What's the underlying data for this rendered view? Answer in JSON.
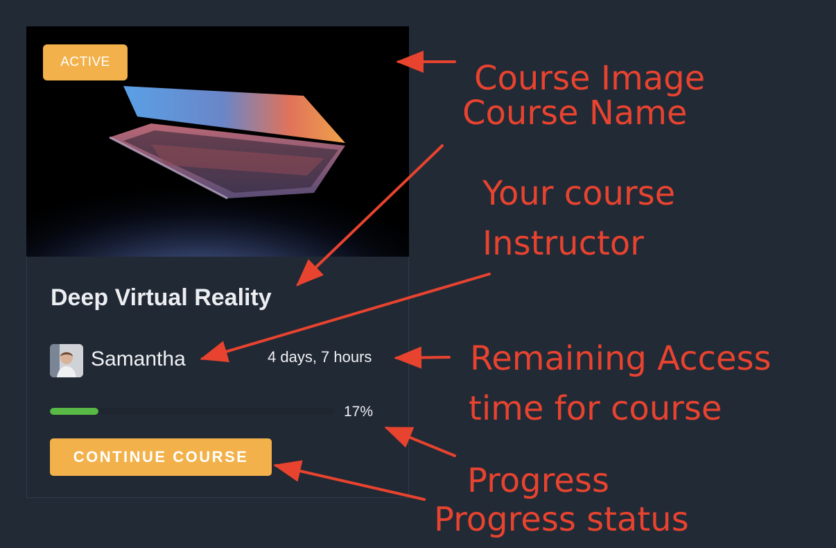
{
  "course_card": {
    "badge": "ACTIVE",
    "course_name": "Deep Virtual Reality",
    "instructor_name": "Samantha",
    "remaining_access": "4 days, 7 hours",
    "progress_fraction": 0.17,
    "progress_label": "17%",
    "cta_label": "CONTINUE COURSE"
  },
  "annotations": {
    "course_image": "Course Image",
    "course_name": "Course Name",
    "instructor_line1": "Your course",
    "instructor_line2": "Instructor",
    "access_line1": "Remaining Access",
    "access_line2": "time for course",
    "progress": "Progress",
    "progress_status": "Progress status"
  },
  "colors": {
    "background": "#222a36",
    "accent": "#f2b14a",
    "progress": "#58b946",
    "annotation": "#e8432f"
  }
}
